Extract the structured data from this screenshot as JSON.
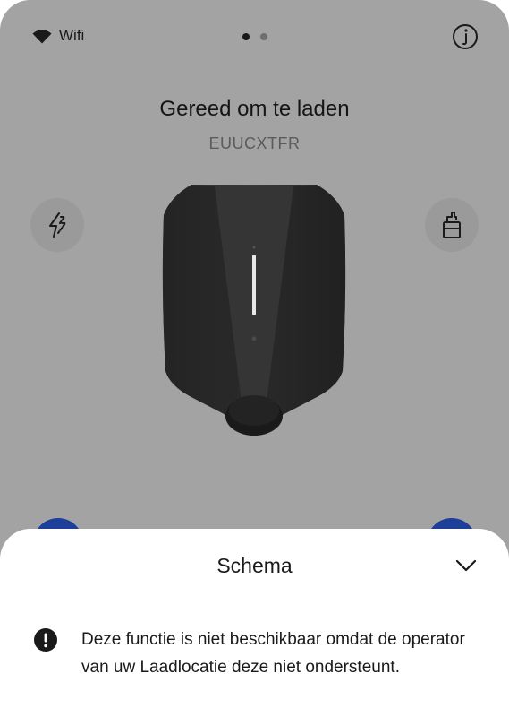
{
  "status": {
    "connection_label": "Wifi",
    "connection_icon": "wifi-icon",
    "pages": 2,
    "active_page": 1,
    "info_icon": "info-icon"
  },
  "charger": {
    "state": "Gereed om te laden",
    "serial": "EUUCXTFR",
    "left_action_icon": "lightning-off-icon",
    "right_action_icon": "cable-lock-icon"
  },
  "sheet": {
    "title": "Schema",
    "collapse_icon": "chevron-down-icon",
    "notice_icon": "alert-circle-icon",
    "notice_text": "Deze functie is niet beschikbaar omdat de operator van uw Laadlocatie deze niet ondersteunt."
  },
  "colors": {
    "overlay": "#a3a3a3",
    "accent_blue": "#1d3f9a",
    "text_dark": "#1a1a1a"
  }
}
